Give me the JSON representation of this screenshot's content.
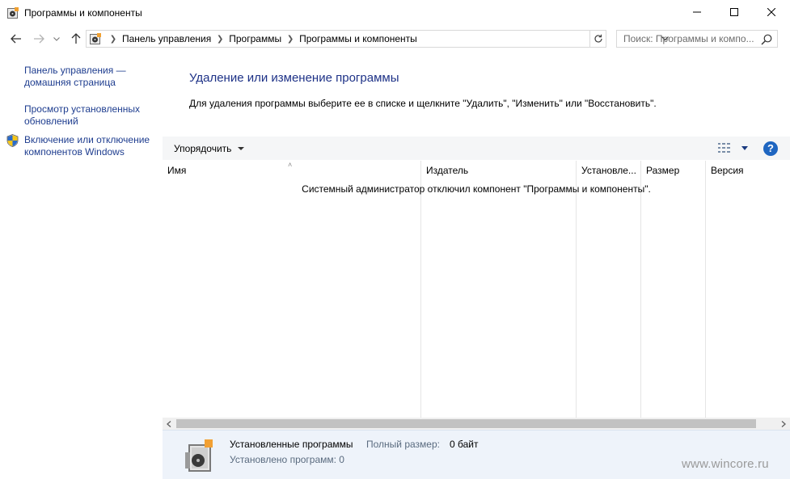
{
  "window": {
    "title": "Программы и компоненты",
    "controls": {
      "minimize": "minimize-icon",
      "maximize": "maximize-icon",
      "close": "close-icon"
    }
  },
  "nav": {
    "back": "back-arrow-icon",
    "forward": "forward-arrow-icon",
    "recent": "chevron-down-icon",
    "up": "up-arrow-icon",
    "breadcrumbs": [
      "Панель управления",
      "Программы",
      "Программы и компоненты"
    ],
    "search_placeholder": "Поиск: Программы и компо..."
  },
  "left_pane": {
    "links": [
      "Панель управления — домашняя страница",
      "Просмотр установленных обновлений",
      "Включение или отключение компонентов Windows"
    ]
  },
  "main": {
    "heading": "Удаление или изменение программы",
    "description": "Для удаления программы выберите ее в списке и щелкните \"Удалить\", \"Изменить\" или \"Восстановить\".",
    "toolbar": {
      "organize": "Упорядочить",
      "view_icon": "view-options-icon",
      "help": "?"
    },
    "columns": [
      "Имя",
      "Издатель",
      "Установле...",
      "Размер",
      "Версия"
    ],
    "empty_message": "Системный администратор отключил компонент \"Программы и компоненты\"."
  },
  "details": {
    "title": "Установленные программы",
    "size_label": "Полный размер:",
    "size_value": "0 байт",
    "count": "Установлено программ: 0"
  },
  "watermark": "www.wincore.ru",
  "colors": {
    "link": "#1e3d8f",
    "heading": "#1e3287",
    "accent": "#1f66c1",
    "details_bg": "#eef3fa"
  }
}
